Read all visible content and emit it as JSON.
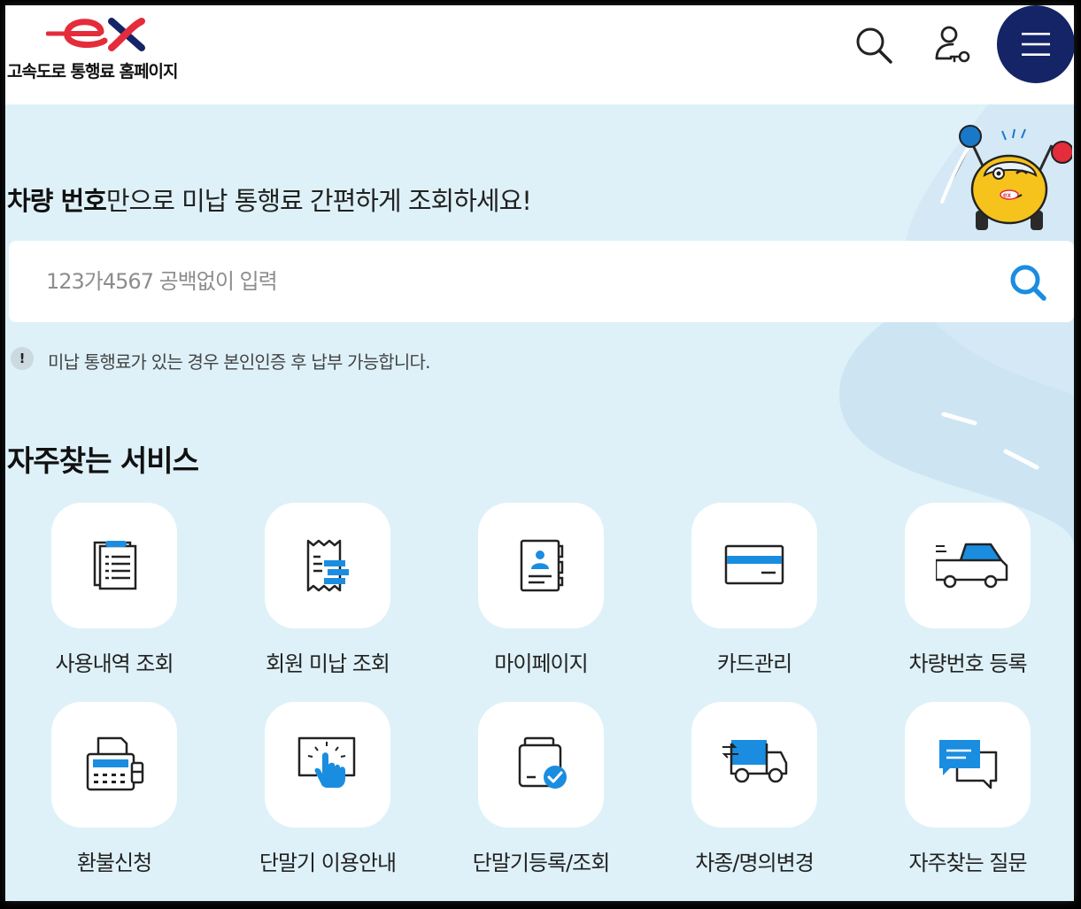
{
  "header": {
    "logo_word": "ex",
    "site_title": "고속도로 통행료 홈페이지",
    "search_icon": "search-icon",
    "user_icon": "user-key-icon",
    "menu_icon": "hamburger-menu-icon"
  },
  "hero": {
    "headline_bold": "차량 번호",
    "headline_rest": "만으로 미납 통행료 간편하게 조회하세요!",
    "search_placeholder": "123가4567 공백없이 입력",
    "search_value": "",
    "notice_mark": "!",
    "notice_text": "미납 통행료가 있는 경우 본인인증 후 납부 가능합니다."
  },
  "services": {
    "title": "자주찾는 서비스",
    "items": [
      {
        "label": "사용내역 조회",
        "icon": "clipboard-list-icon"
      },
      {
        "label": "회원 미납 조회",
        "icon": "receipt-icon"
      },
      {
        "label": "마이페이지",
        "icon": "profile-book-icon"
      },
      {
        "label": "카드관리",
        "icon": "card-icon"
      },
      {
        "label": "차량번호 등록",
        "icon": "car-icon"
      },
      {
        "label": "환불신청",
        "icon": "fax-machine-icon"
      },
      {
        "label": "단말기 이용안내",
        "icon": "touch-screen-icon"
      },
      {
        "label": "단말기등록/조회",
        "icon": "device-check-icon"
      },
      {
        "label": "차종/명의변경",
        "icon": "truck-exchange-icon"
      },
      {
        "label": "자주찾는 질문",
        "icon": "chat-bubbles-icon"
      }
    ]
  },
  "colors": {
    "accent_blue": "#1a8de0",
    "navy": "#142466",
    "brand_red": "#e42c3b",
    "background": "#def1f8"
  }
}
